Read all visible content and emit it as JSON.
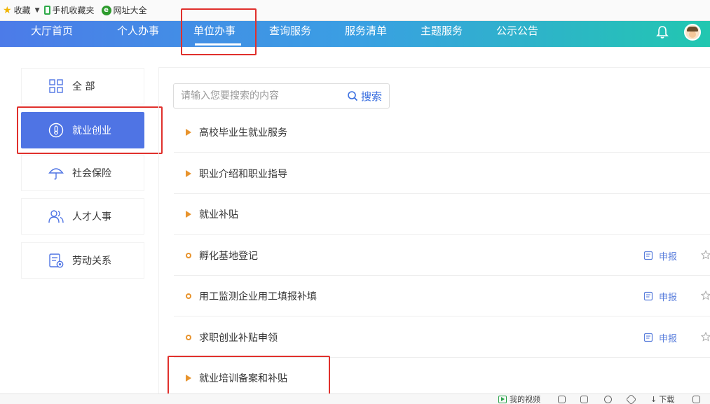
{
  "bookmarks": {
    "items": [
      {
        "label": "收藏",
        "icon": "star-icon"
      },
      {
        "label": "手机收藏夹",
        "icon": "phone-icon"
      },
      {
        "label": "网址大全",
        "icon": "globe-icon"
      }
    ]
  },
  "nav": {
    "items": [
      {
        "label": "大厅首页"
      },
      {
        "label": "个人办事"
      },
      {
        "label": "单位办事",
        "active": true
      },
      {
        "label": "查询服务"
      },
      {
        "label": "服务清单"
      },
      {
        "label": "主题服务"
      },
      {
        "label": "公示公告"
      }
    ],
    "icons": [
      "bell-icon",
      "avatar"
    ]
  },
  "categories": [
    {
      "label": "全 部",
      "icon": "grid-icon"
    },
    {
      "label": "就业创业",
      "icon": "thermometer-icon",
      "active": true
    },
    {
      "label": "社会保险",
      "icon": "umbrella-icon"
    },
    {
      "label": "人才人事",
      "icon": "people-icon"
    },
    {
      "label": "劳动关系",
      "icon": "contract-icon"
    }
  ],
  "search": {
    "placeholder": "请输入您要搜索的内容",
    "button_label": "搜索"
  },
  "services": [
    {
      "label": "高校毕业生就业服务",
      "marker": "triangle"
    },
    {
      "label": "职业介绍和职业指导",
      "marker": "triangle"
    },
    {
      "label": "就业补贴",
      "marker": "triangle"
    },
    {
      "label": "孵化基地登记",
      "marker": "circle",
      "action": "申报"
    },
    {
      "label": "用工监测企业用工填报补填",
      "marker": "circle",
      "action": "申报"
    },
    {
      "label": "求职创业补贴申领",
      "marker": "circle",
      "action": "申报"
    },
    {
      "label": "就业培训备案和补贴",
      "marker": "triangle"
    }
  ],
  "statusbar": {
    "video_label": "我的视频",
    "download_label": "下载"
  },
  "colors": {
    "nav_gradient_start": "#4c7be8",
    "nav_gradient_end": "#22c7b0",
    "active_category": "#4f74e4",
    "marker": "#e8932c",
    "highlight_box": "#e0302c",
    "link": "#5b7fdc"
  }
}
